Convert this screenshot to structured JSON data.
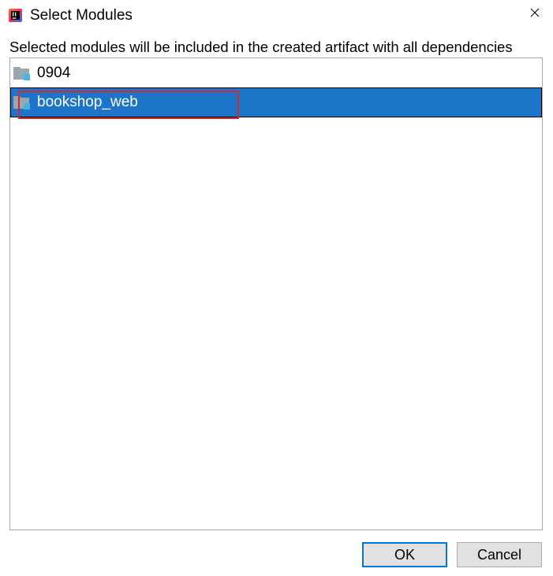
{
  "window": {
    "title": "Select Modules",
    "icon": "intellij-app-icon",
    "close_icon": "close-icon"
  },
  "description": "Selected modules will be included in the created artifact with all dependencies",
  "modules": [
    {
      "label": "0904",
      "icon": "module-folder-icon",
      "selected": false
    },
    {
      "label": "bookshop_web",
      "icon": "module-folder-icon",
      "selected": true
    }
  ],
  "annotation": {
    "color": "#d9262b",
    "target": "bookshop_web"
  },
  "buttons": {
    "ok": "OK",
    "cancel": "Cancel"
  },
  "colors": {
    "selection": "#1c75c8",
    "default_button_border": "#0078d7",
    "highlight": "#d9262b"
  }
}
